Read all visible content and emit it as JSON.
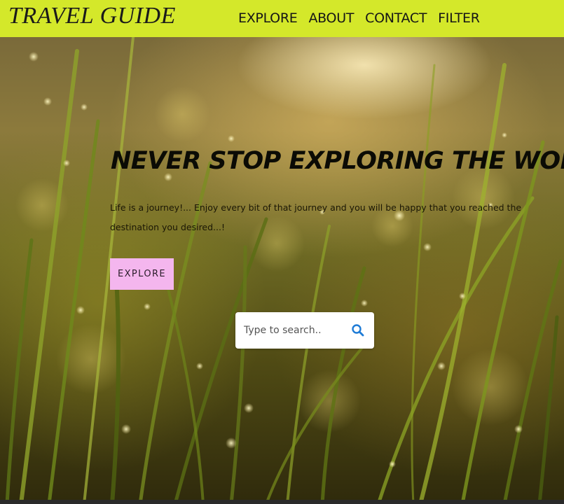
{
  "header": {
    "logo": "TRAVEL GUIDE",
    "nav": [
      {
        "label": "EXPLORE"
      },
      {
        "label": "ABOUT"
      },
      {
        "label": "CONTACT"
      },
      {
        "label": "FILTER"
      }
    ]
  },
  "hero": {
    "title": "NEVER STOP EXPLORING THE WORLD",
    "subtitle": "Life is a journey!... Enjoy every bit of that journey and you will be happy that you reached the destination you desired...!",
    "cta_label": "EXPLORE"
  },
  "search": {
    "placeholder": "Type to search..",
    "icon": "search-icon"
  },
  "colors": {
    "navbar_bg": "#d4e82a",
    "cta_bg": "#f4b6ee",
    "search_icon": "#1e7bd6"
  }
}
